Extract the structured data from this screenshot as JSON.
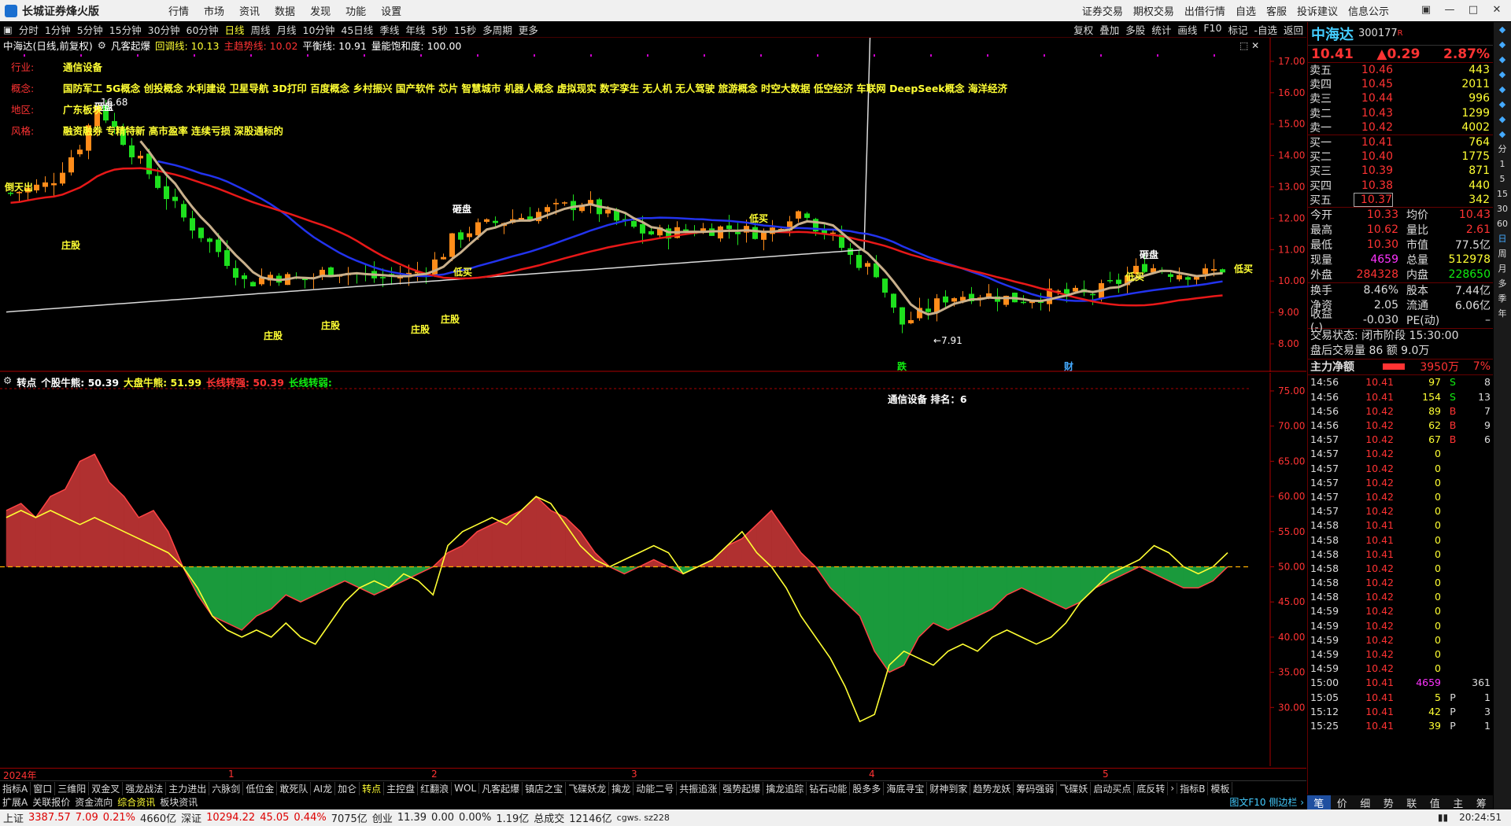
{
  "app": {
    "title": "长城证券烽火版",
    "menu": [
      "行情",
      "市场",
      "资讯",
      "数据",
      "发现",
      "功能",
      "设置"
    ],
    "right_menu": [
      "证券交易",
      "期权交易",
      "出借行情",
      "自选",
      "客服",
      "投诉建议",
      "信息公示"
    ]
  },
  "toolbar": {
    "periods": [
      "分时",
      "1分钟",
      "5分钟",
      "15分钟",
      "30分钟",
      "60分钟",
      "日线",
      "周线",
      "月线",
      "10分钟",
      "45日线",
      "季线",
      "年线",
      "5秒",
      "15秒",
      "多周期",
      "更多"
    ],
    "active": "日线",
    "right": [
      "复权",
      "叠加",
      "多股",
      "统计",
      "画线",
      "F10",
      "标记",
      "-自选",
      "返回"
    ]
  },
  "main_chart": {
    "legend": {
      "name": "中海达(日线,前复权)",
      "indicator": "凡客起爆",
      "items": [
        {
          "label": "回调线: 10.13",
          "color": "#ff3"
        },
        {
          "label": "主趋势线: 10.02",
          "color": "#f33"
        },
        {
          "label": "平衡线: 10.91",
          "color": "#fff"
        },
        {
          "label": "量能饱和度: 100.00",
          "color": "#fff"
        }
      ]
    },
    "info": [
      {
        "label": "行业:",
        "value": "通信设备"
      },
      {
        "label": "概念:",
        "value": "国防军工 5G概念 创投概念 水利建设 卫星导航 3D打印 百度概念 乡村振兴 国产软件 芯片 智慧城市 机器人概念 虚拟现实 数字孪生 无人机 无人驾驶 旅游概念 时空大数据 低空经济 车联网 DeepSeek概念 海洋经济"
      },
      {
        "label": "地区:",
        "value": "广东板块"
      },
      {
        "label": "风格:",
        "value": "融资融券 专精特新 高市盈率 连续亏损 深股通标的"
      }
    ],
    "y_ticks": [
      "17.00",
      "16.00",
      "15.00",
      "14.00",
      "13.00",
      "12.00",
      "11.00",
      "10.00",
      "9.00",
      "8.00"
    ],
    "ylim": [
      7.6,
      17.5
    ],
    "annotations": {
      "high": "16.68",
      "low": "7.91",
      "labels": [
        "庄股",
        "庄股",
        "庄股",
        "庄股",
        "庄股",
        "庄股",
        "低买",
        "低买",
        "低买",
        "低买",
        "砸盘",
        "砸盘",
        "砸盘",
        "倒天出"
      ],
      "bottom_markers": [
        "跌",
        "财"
      ]
    },
    "colors": {
      "up": "#ff8c1a",
      "down": "#1ee01e",
      "ma_short": "#c9b08c",
      "ma_blue": "#2233ee",
      "ma_red": "#e81818",
      "ma_white": "#dcdcdc"
    }
  },
  "indicator": {
    "legend": [
      {
        "label": "转点",
        "color": "#fff"
      },
      {
        "label": "个股牛熊: 50.39",
        "color": "#fff"
      },
      {
        "label": "大盘牛熊: 51.99",
        "color": "#ff3"
      },
      {
        "label": "长线转强: 50.39",
        "color": "#f33"
      },
      {
        "label": "长线转弱:",
        "color": "#1e1"
      }
    ],
    "rank_text": "通信设备    排名：6",
    "y_ticks": [
      "75.00",
      "70.00",
      "65.00",
      "60.00",
      "55.00",
      "50.00",
      "45.00",
      "40.00",
      "35.00",
      "30.00"
    ]
  },
  "chart_data": {
    "type": "line",
    "title": "中海达(日线,前复权)",
    "x_labels": [
      "2024年",
      "1",
      "2",
      "3",
      "4",
      "5"
    ],
    "series": [
      {
        "name": "个股牛熊",
        "values": [
          58,
          59,
          57,
          60,
          61,
          65,
          66,
          62,
          60,
          57,
          58,
          55,
          50,
          46,
          43,
          42,
          41,
          43,
          44,
          46,
          45,
          46,
          47,
          48,
          47,
          46,
          47,
          48,
          49,
          50,
          52,
          53,
          55,
          56,
          57,
          58,
          60,
          58,
          57,
          55,
          52,
          50,
          49,
          50,
          51,
          50,
          49,
          50,
          51,
          53,
          54,
          56,
          58,
          55,
          52,
          50,
          47,
          45,
          43,
          38,
          35,
          36,
          40,
          42,
          41,
          42,
          43,
          44,
          46,
          47,
          46,
          45,
          44,
          45,
          47,
          48,
          49,
          50,
          49,
          48,
          47,
          47,
          48,
          50
        ]
      },
      {
        "name": "大盘牛熊",
        "values": [
          57,
          58,
          57,
          58,
          57,
          56,
          57,
          56,
          55,
          54,
          53,
          52,
          50,
          47,
          43,
          41,
          40,
          41,
          40,
          42,
          40,
          39,
          42,
          45,
          47,
          48,
          47,
          49,
          48,
          46,
          53,
          55,
          56,
          57,
          56,
          58,
          60,
          59,
          56,
          53,
          51,
          50,
          51,
          52,
          53,
          52,
          49,
          50,
          51,
          53,
          55,
          52,
          50,
          47,
          43,
          40,
          37,
          33,
          28,
          29,
          36,
          38,
          37,
          36,
          38,
          39,
          38,
          40,
          41,
          40,
          39,
          40,
          42,
          45,
          47,
          49,
          50,
          51,
          53,
          52,
          50,
          49,
          50,
          52
        ]
      }
    ],
    "xlabel": "",
    "ylabel": ""
  },
  "x_axis": [
    {
      "text": "2024年",
      "x": 4
    },
    {
      "text": "1",
      "x": 290
    },
    {
      "text": "2",
      "x": 548
    },
    {
      "text": "3",
      "x": 802
    },
    {
      "text": "4",
      "x": 1104
    },
    {
      "text": "5",
      "x": 1401
    }
  ],
  "bottom_tabs": {
    "row1": [
      "指标A",
      "窗口",
      "三维阳",
      "双金叉",
      "强龙战法",
      "主力进出",
      "六脉剑",
      "低位金",
      "敢死队",
      "AI龙",
      "加仑",
      "转点",
      "主控盘",
      "红翻浪",
      "WOL",
      "凡客起爆",
      "镇店之宝",
      "飞碟妖龙",
      "擒龙",
      "动能二号",
      "共振追涨",
      "强势起爆",
      "擒龙追踪",
      "钻石动能",
      "股多多",
      "海底寻宝",
      "财神到家",
      "趋势龙妖",
      "筹码强弱",
      "飞碟妖",
      "启动买点",
      "底反转"
    ],
    "row1_active": "转点",
    "row1_right": [
      "指标B",
      "模板"
    ],
    "row2": [
      "扩展A",
      "关联报价",
      "资金流向",
      "综合资讯",
      "板块资讯"
    ],
    "row2_active": "综合资讯",
    "row2_right": "图文F10 侧边栏 ›"
  },
  "status": {
    "sh_label": "上证",
    "sh_val": "3387.57",
    "sh_chg": "7.09",
    "sh_pct": "0.21%",
    "sh_amt": "4660亿",
    "sz_label": "深证",
    "sz_val": "10294.22",
    "sz_chg": "45.05",
    "sz_pct": "0.44%",
    "sz_amt": "7075亿",
    "cy_label": "创业",
    "cy_val": "11.39",
    "cy_chg": "0.00",
    "cy_pct": "0.00%",
    "cy_amt": "1.19亿",
    "total_label": "总成交",
    "total_val": "12146亿",
    "server": "cgws. sz228",
    "time": "20:24:51"
  },
  "quote": {
    "name": "中海达",
    "code": "300177",
    "flag": "R",
    "price": "10.41",
    "change": "▲0.29",
    "pct": "2.87%",
    "asks": [
      {
        "label": "卖五",
        "price": "10.46",
        "vol": "443"
      },
      {
        "label": "卖四",
        "price": "10.45",
        "vol": "2011"
      },
      {
        "label": "卖三",
        "price": "10.44",
        "vol": "996"
      },
      {
        "label": "卖二",
        "price": "10.43",
        "vol": "1299"
      },
      {
        "label": "卖一",
        "price": "10.42",
        "vol": "4002"
      }
    ],
    "bids": [
      {
        "label": "买一",
        "price": "10.41",
        "vol": "764"
      },
      {
        "label": "买二",
        "price": "10.40",
        "vol": "1775"
      },
      {
        "label": "买三",
        "price": "10.39",
        "vol": "871"
      },
      {
        "label": "买四",
        "price": "10.38",
        "vol": "440"
      },
      {
        "label": "买五",
        "price": "10.37",
        "vol": "342"
      }
    ],
    "stats": [
      {
        "k": "今开",
        "v": "10.33",
        "c": "#f33",
        "k2": "均价",
        "v2": "10.43",
        "c2": "#f33"
      },
      {
        "k": "最高",
        "v": "10.62",
        "c": "#f33",
        "k2": "量比",
        "v2": "2.61",
        "c2": "#f33"
      },
      {
        "k": "最低",
        "v": "10.30",
        "c": "#f33",
        "k2": "市值",
        "v2": "77.5亿",
        "c2": "#ddd"
      },
      {
        "k": "现量",
        "v": "4659",
        "c": "#f3f",
        "k2": "总量",
        "v2": "512978",
        "c2": "#ff3"
      },
      {
        "k": "外盘",
        "v": "284328",
        "c": "#f33",
        "k2": "内盘",
        "v2": "228650",
        "c2": "#1e1"
      }
    ],
    "stats2": [
      {
        "k": "换手",
        "v": "8.46%",
        "c": "#ddd",
        "k2": "股本",
        "v2": "7.44亿",
        "c2": "#ddd"
      },
      {
        "k": "净资",
        "v": "2.05",
        "c": "#ddd",
        "k2": "流通",
        "v2": "6.06亿",
        "c2": "#ddd"
      },
      {
        "k": "收益(-)",
        "v": "-0.030",
        "c": "#ddd",
        "k2": "PE(动)",
        "v2": "–",
        "c2": "#ddd"
      }
    ],
    "trade_state": "交易状态: 闭市阶段 15:30:00",
    "after": "盘后交易量 86 额 9.0万",
    "main_flow_label": "主力净额",
    "main_flow": "3950万",
    "main_flow_pct": "7%"
  },
  "ticks": [
    [
      "14:56",
      "10.41",
      "97",
      "S",
      "8"
    ],
    [
      "14:56",
      "10.41",
      "154",
      "S",
      "13"
    ],
    [
      "14:56",
      "10.42",
      "89",
      "B",
      "7"
    ],
    [
      "14:56",
      "10.42",
      "62",
      "B",
      "9"
    ],
    [
      "14:57",
      "10.42",
      "67",
      "B",
      "6"
    ],
    [
      "14:57",
      "10.42",
      "0",
      "",
      ""
    ],
    [
      "14:57",
      "10.42",
      "0",
      "",
      ""
    ],
    [
      "14:57",
      "10.42",
      "0",
      "",
      ""
    ],
    [
      "14:57",
      "10.42",
      "0",
      "",
      ""
    ],
    [
      "14:57",
      "10.42",
      "0",
      "",
      ""
    ],
    [
      "14:58",
      "10.41",
      "0",
      "",
      ""
    ],
    [
      "14:58",
      "10.41",
      "0",
      "",
      ""
    ],
    [
      "14:58",
      "10.41",
      "0",
      "",
      ""
    ],
    [
      "14:58",
      "10.42",
      "0",
      "",
      ""
    ],
    [
      "14:58",
      "10.42",
      "0",
      "",
      ""
    ],
    [
      "14:58",
      "10.42",
      "0",
      "",
      ""
    ],
    [
      "14:59",
      "10.42",
      "0",
      "",
      ""
    ],
    [
      "14:59",
      "10.42",
      "0",
      "",
      ""
    ],
    [
      "14:59",
      "10.42",
      "0",
      "",
      ""
    ],
    [
      "14:59",
      "10.42",
      "0",
      "",
      ""
    ],
    [
      "14:59",
      "10.42",
      "0",
      "",
      ""
    ],
    [
      "15:00",
      "10.41",
      "4659",
      "",
      "361"
    ],
    [
      "15:05",
      "10.41",
      "5",
      "P",
      "1"
    ],
    [
      "15:12",
      "10.41",
      "42",
      "P",
      "3"
    ],
    [
      "15:25",
      "10.41",
      "39",
      "P",
      "1"
    ]
  ],
  "right_tabs": [
    "笔",
    "价",
    "细",
    "势",
    "联",
    "值",
    "主",
    "筹"
  ],
  "sidebar": [
    "分",
    "1",
    "5",
    "15",
    "30",
    "60",
    "日",
    "周",
    "月",
    "多",
    "季",
    "年"
  ]
}
